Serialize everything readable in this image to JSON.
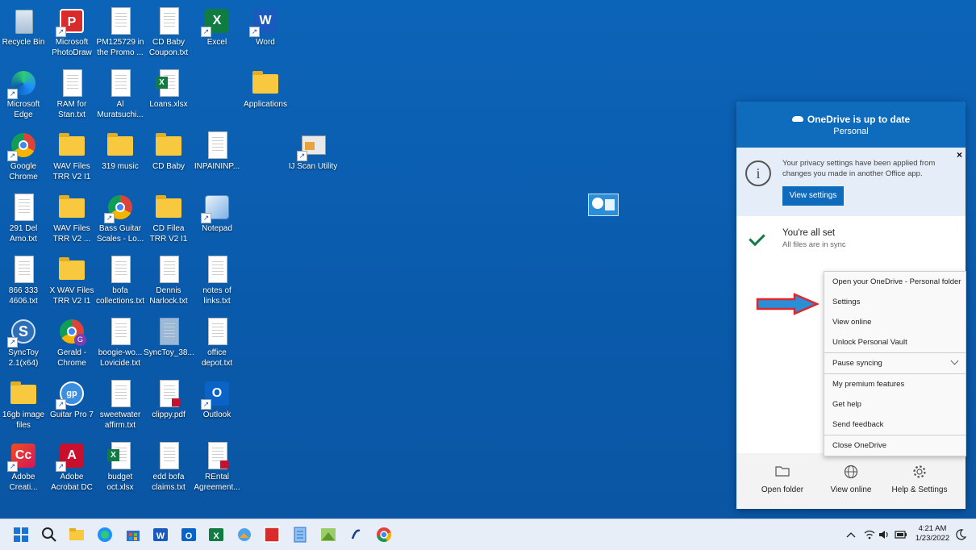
{
  "desktop": {
    "icons": [
      {
        "label": "Recycle Bin"
      },
      {
        "label": "Microsoft PhotoDraw"
      },
      {
        "label": "PM125729 in the Promo ..."
      },
      {
        "label": "CD Baby Coupon.txt"
      },
      {
        "label": "Excel"
      },
      {
        "label": "Word"
      },
      {
        "label": "Microsoft Edge"
      },
      {
        "label": "RAM for Stan.txt"
      },
      {
        "label": "Al Muratsuchi..."
      },
      {
        "label": "Loans.xlsx"
      },
      {
        "label": "Applications"
      },
      {
        "label": "Google Chrome"
      },
      {
        "label": "WAV Files TRR V2 I1"
      },
      {
        "label": "319 music"
      },
      {
        "label": "CD Baby"
      },
      {
        "label": "INPAININP..."
      },
      {
        "label": "IJ Scan Utility"
      },
      {
        "label": "291 Del Amo.txt"
      },
      {
        "label": "WAV Files TRR V2 ..."
      },
      {
        "label": "Bass Guitar Scales - Lo..."
      },
      {
        "label": "CD Filea TRR V2 I1"
      },
      {
        "label": "Notepad"
      },
      {
        "label": "866 333 4606.txt"
      },
      {
        "label": "X WAV Files TRR V2 I1"
      },
      {
        "label": "bofa collections.txt"
      },
      {
        "label": "Dennis Narlock.txt"
      },
      {
        "label": "notes of links.txt"
      },
      {
        "label": "SyncToy 2.1(x64)"
      },
      {
        "label": "Gerald - Chrome"
      },
      {
        "label": "boogie-wo... Lovicide.txt"
      },
      {
        "label": "SyncToy_38..."
      },
      {
        "label": "office depot.txt"
      },
      {
        "label": "16gb image files"
      },
      {
        "label": "Guitar Pro 7"
      },
      {
        "label": "sweetwater affirm.txt"
      },
      {
        "label": "clippy.pdf"
      },
      {
        "label": "Outlook"
      },
      {
        "label": "Adobe Creati..."
      },
      {
        "label": "Adobe Acrobat DC"
      },
      {
        "label": "budget oct.xlsx"
      },
      {
        "label": "edd bofa claims.txt"
      },
      {
        "label": "REntal Agreement..."
      }
    ]
  },
  "onedrive": {
    "title": "OneDrive is up to date",
    "account": "Personal",
    "notice": "Your privacy settings have been applied from changes you made in another Office app.",
    "close_glyph": "×",
    "view_settings": "View settings",
    "status_title": "You're all set",
    "status_sub": "All files are in sync",
    "footer": [
      {
        "label": "Open folder",
        "icon": "folder-icon"
      },
      {
        "label": "View online",
        "icon": "globe-icon"
      },
      {
        "label": "Help & Settings",
        "icon": "gear-icon"
      }
    ]
  },
  "menu": {
    "items": [
      "Open your OneDrive - Personal folder",
      "Settings",
      "View online",
      "Unlock Personal Vault",
      "Pause syncing",
      "My premium features",
      "Get help",
      "Send feedback",
      "Close OneDrive"
    ]
  },
  "taskbar": {
    "time": "4:21 AM",
    "date": "1/23/2022"
  },
  "colors": {
    "desktop": "#0a5cad",
    "onedrive_blue": "#0f6cbd",
    "arrow_red": "#e0262b",
    "arrow_blue": "#2a8fd6"
  }
}
